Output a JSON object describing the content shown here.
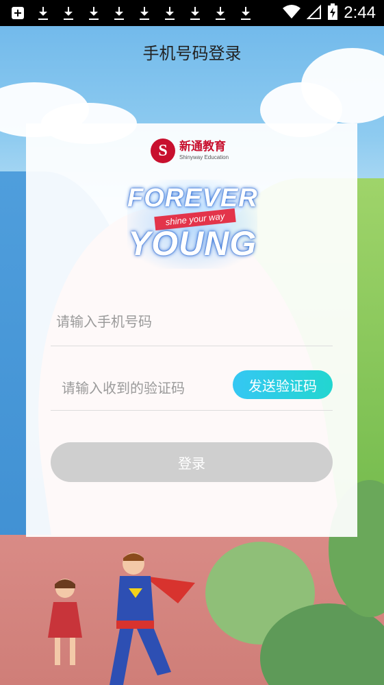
{
  "status_bar": {
    "left_icons": [
      "add-box-icon",
      "download-icon",
      "download-icon",
      "download-icon",
      "download-icon",
      "download-icon",
      "download-icon",
      "download-icon",
      "download-icon",
      "download-icon"
    ],
    "time": "2:44"
  },
  "header": {
    "title": "手机号码登录"
  },
  "brand": {
    "name_cn": "新通教育",
    "name_en": "Shinyway Education"
  },
  "banner": {
    "line1": "FOREVER",
    "ribbon": "shine your way",
    "line2": "YOUNG"
  },
  "form": {
    "phone_placeholder": "请输入手机号码",
    "code_placeholder": "请输入收到的验证码",
    "send_code_label": "发送验证码",
    "login_label": "登录"
  },
  "colors": {
    "brand_red": "#c8102e",
    "send_button": "#2ad0e0",
    "login_button_disabled": "#cfcfcf"
  }
}
